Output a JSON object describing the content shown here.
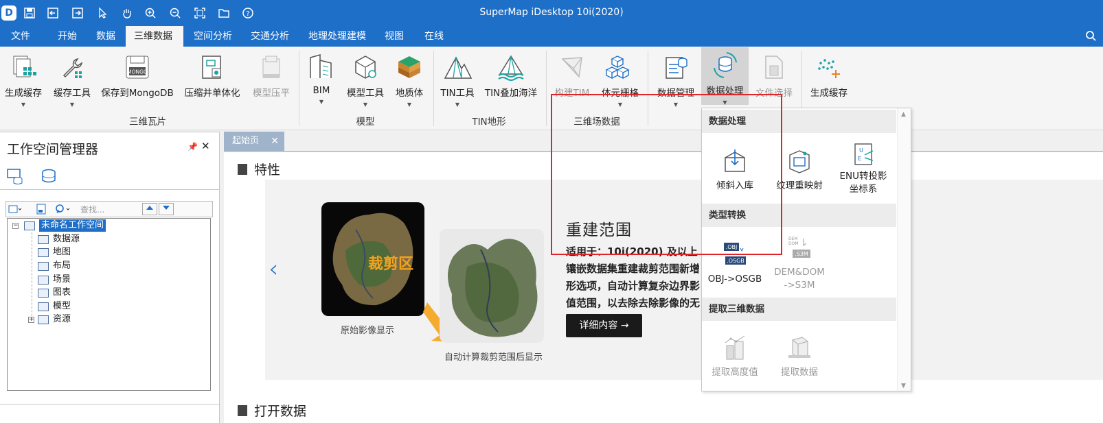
{
  "app": {
    "title": "SuperMap iDesktop 10i(2020)"
  },
  "colors": {
    "accent": "#1e6fc8",
    "highlight": "#e0242a",
    "disabled": "#999999"
  },
  "quick_access": [
    "app-logo",
    "save-icon",
    "import-icon",
    "export-icon",
    "pointer-icon",
    "pan-icon",
    "zoom-in-icon",
    "zoom-out-icon",
    "full-extent-icon",
    "open-folder-icon",
    "help-icon"
  ],
  "menu": {
    "tabs": [
      "文件",
      "开始",
      "数据",
      "三维数据",
      "空间分析",
      "交通分析",
      "地理处理建模",
      "视图",
      "在线"
    ],
    "active": "三维数据"
  },
  "ribbon": {
    "buttons": {
      "b0": "生成缓存",
      "b1": "缓存工具",
      "b2": "保存到MongoDB",
      "b3": "压缩并单体化",
      "b4": "模型压平",
      "b5": "BIM",
      "b6": "模型工具",
      "b7": "地质体",
      "b8": "TIN工具",
      "b9": "TIN叠加海洋",
      "b10": "构建TIM",
      "b11": "体元栅格",
      "b12": "数据管理",
      "b13": "数据处理",
      "b14": "文件选择",
      "b15": "生成缓存"
    },
    "groups": {
      "g1": "三维瓦片",
      "g2": "模型",
      "g3": "TIN地形",
      "g4": "三维场数据"
    }
  },
  "left_panel": {
    "title": "工作空间管理器",
    "search_placeholder": "查找...",
    "tree": {
      "root": "未命名工作空间",
      "children": {
        "c0": "数据源",
        "c1": "地图",
        "c2": "布局",
        "c3": "场景",
        "c4": "图表",
        "c5": "模型",
        "c6": "资源"
      }
    }
  },
  "doc_tab": {
    "label": "起始页"
  },
  "start_page": {
    "section1": "特性",
    "section2": "打开数据",
    "banner": {
      "title": "重建范围",
      "subtitle": "适用于：10i(2020) 及以上",
      "desc_line1": "镶嵌数据集重建裁剪范围新增",
      "desc_line2": "形选项，自动计算复杂边界影",
      "desc_line3": "值范围，以去除去除影像的无",
      "detail_button": "详细内容 →",
      "clip_label": "裁剪区",
      "caption1": "原始影像显示",
      "caption2": "自动计算裁剪范围后显示"
    }
  },
  "dropdown": {
    "sec1": "数据处理",
    "sec2": "类型转换",
    "sec3": "提取三维数据",
    "i1": "倾斜入库",
    "i2": "纹理重映射",
    "i3a": "ENU转投影",
    "i3b": "坐标系",
    "i4": "OBJ->OSGB",
    "i5a": "DEM&DOM",
    "i5b": "->S3M",
    "i6": "提取高度值",
    "i7": "提取数据",
    "icon_text": {
      "obj": ".OBJ",
      "osgb": ".OSGB",
      "dem": "DEM",
      "dom": "DOM",
      "s3m": ".S3M"
    }
  }
}
